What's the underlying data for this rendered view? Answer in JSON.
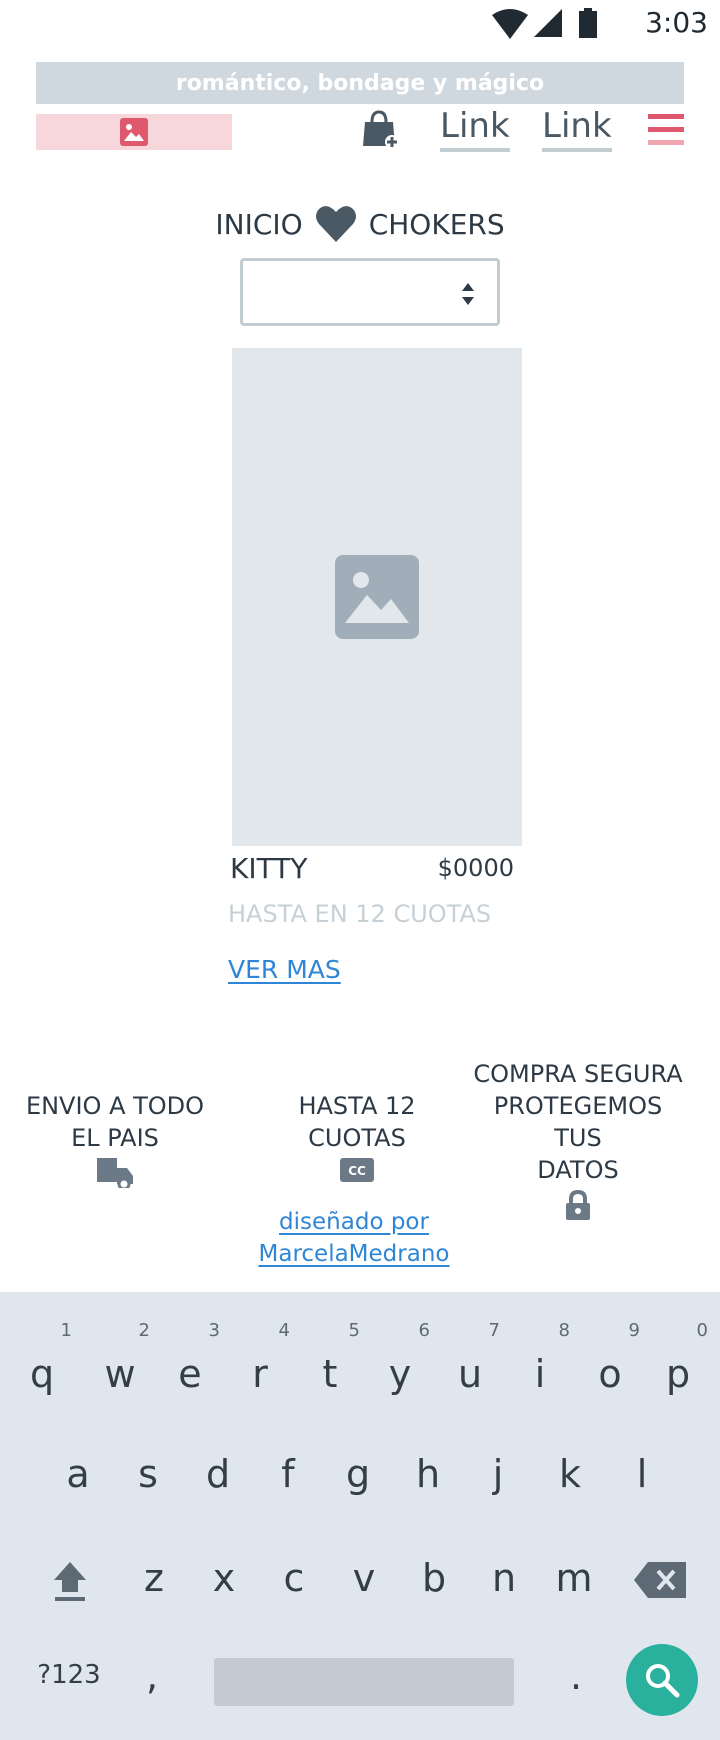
{
  "status_bar": {
    "time": "3:03",
    "icons": [
      "wifi-icon",
      "signal-icon",
      "battery-icon"
    ]
  },
  "promo": {
    "text": "romántico, bondage y mágico"
  },
  "header": {
    "logo_icon": "image-icon",
    "cart_icon": "shopping-bag-add-icon",
    "links": [
      "Link",
      "Link"
    ],
    "menu_icon": "hamburger-menu-icon"
  },
  "breadcrumb": {
    "home": "INICIO",
    "separator_icon": "heart-icon",
    "current": "CHOKERS"
  },
  "select": {
    "value": ""
  },
  "product": {
    "image_icon": "image-placeholder-icon",
    "name": "KITTY",
    "price": "$0000",
    "installments": "HASTA EN 12 CUOTAS",
    "cta": "VER MAS"
  },
  "features": [
    {
      "line1": "ENVIO A TODO",
      "line2": "EL PAIS",
      "icon": "delivery-truck-icon"
    },
    {
      "line1": "HASTA 12",
      "line2": "CUOTAS",
      "icon": "credit-card-icon"
    },
    {
      "line1": "COMPRA SEGURA",
      "line2": "PROTEGEMOS TUS",
      "line3": "DATOS",
      "icon": "lock-icon"
    }
  ],
  "designer": {
    "line1": "diseñado por",
    "line2": "MarcelaMedrano"
  },
  "keyboard": {
    "row1": [
      "q",
      "w",
      "e",
      "r",
      "t",
      "y",
      "u",
      "i",
      "o",
      "p"
    ],
    "row1_hints": [
      "1",
      "2",
      "3",
      "4",
      "5",
      "6",
      "7",
      "8",
      "9",
      "0"
    ],
    "row2": [
      "a",
      "s",
      "d",
      "f",
      "g",
      "h",
      "j",
      "k",
      "l"
    ],
    "row3": [
      "z",
      "x",
      "c",
      "v",
      "b",
      "n",
      "m"
    ],
    "symbols_key": "?123",
    "comma": ",",
    "period": ".",
    "colors": {
      "background": "#e0e6ed",
      "search": "#29b19d"
    }
  },
  "colors": {
    "accent": "#e0586e",
    "link": "#2f86d6",
    "banner": "#cfd8df"
  }
}
